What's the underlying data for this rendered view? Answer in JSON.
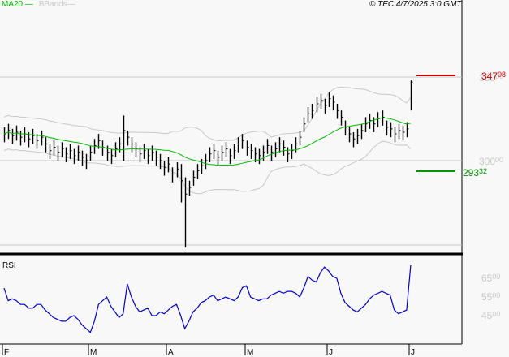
{
  "header": {
    "legend_ma": "MA20",
    "legend_bb": "BBands",
    "copyright": "© TEC 4/7/2025 3:0 GMT"
  },
  "colors": {
    "ma": "#00bb00",
    "bands": "#c8c8c8",
    "bars": "#000000",
    "rsi": "#0000cc",
    "last": "#cc0000",
    "low": "#009900",
    "grid": "#c8c8c8"
  },
  "chart_data": [
    {
      "type": "ohlc-bar",
      "title": "Price",
      "ylim": [
        245,
        360
      ],
      "yticks": [
        {
          "value": 350,
          "label": "350",
          "dec": "00"
        },
        {
          "value": 300,
          "label": "300",
          "dec": "00"
        }
      ],
      "last_price": {
        "value": 347.08,
        "label": "347",
        "dec": "08"
      },
      "low_level": {
        "value": 293.32,
        "label": "293",
        "dec": "32"
      },
      "xticks": [
        {
          "index": 0,
          "label": "F"
        },
        {
          "index": 21,
          "label": "M"
        },
        {
          "index": 40,
          "label": "A"
        },
        {
          "index": 59,
          "label": "M"
        },
        {
          "index": 79,
          "label": "J"
        },
        {
          "index": 99,
          "label": "J"
        }
      ],
      "close": [
        316,
        318,
        315,
        317,
        314,
        316,
        313,
        315,
        312,
        314,
        310,
        306,
        308,
        305,
        307,
        304,
        306,
        303,
        305,
        302,
        300,
        305,
        309,
        312,
        308,
        305,
        303,
        307,
        310,
        318,
        314,
        310,
        307,
        304,
        306,
        303,
        305,
        302,
        300,
        296,
        298,
        292,
        295,
        288,
        280,
        284,
        290,
        294,
        297,
        300,
        304,
        306,
        302,
        305,
        307,
        303,
        306,
        310,
        312,
        308,
        306,
        304,
        303,
        305,
        309,
        305,
        307,
        310,
        308,
        304,
        306,
        310,
        314,
        322,
        328,
        330,
        334,
        336,
        333,
        337,
        335,
        330,
        326,
        320,
        316,
        313,
        315,
        318,
        322,
        324,
        322,
        325,
        326,
        320,
        319,
        316,
        318,
        317,
        319,
        347
      ],
      "high_special": {
        "29": 327,
        "43": 298,
        "44": 290,
        "99": 348
      },
      "low_special": {
        "29": 300,
        "43": 275,
        "44": 248,
        "99": 330
      },
      "ma_period": 20
    },
    {
      "type": "line",
      "title": "RSI",
      "label": "RSI",
      "ylim": [
        30,
        78
      ],
      "yticks": [
        {
          "value": 65,
          "label": "65",
          "dec": "00"
        },
        {
          "value": 55,
          "label": "55",
          "dec": "00"
        },
        {
          "value": 45,
          "label": "45",
          "dec": "00"
        }
      ],
      "values": [
        59.8,
        53,
        54,
        53,
        51,
        51,
        49,
        49,
        51,
        51,
        48,
        46,
        44,
        43,
        42,
        42,
        44,
        45,
        43,
        40,
        38,
        36,
        42,
        51,
        53,
        55,
        50,
        47,
        44,
        46,
        62,
        55,
        50,
        47,
        48,
        49,
        45,
        45,
        47,
        46,
        48,
        50,
        51,
        45,
        38,
        42,
        47,
        49,
        52,
        53,
        55,
        56,
        53,
        54,
        55,
        54,
        53,
        55,
        60,
        61,
        55,
        54,
        53,
        54,
        54,
        56,
        57,
        58,
        57,
        58,
        58,
        57,
        55,
        60,
        66,
        64,
        63,
        68,
        71,
        69,
        66,
        65,
        57,
        52,
        50,
        48,
        47,
        49,
        51,
        54,
        56,
        57,
        58,
        57,
        56,
        48,
        46,
        47,
        48,
        72
      ]
    }
  ]
}
